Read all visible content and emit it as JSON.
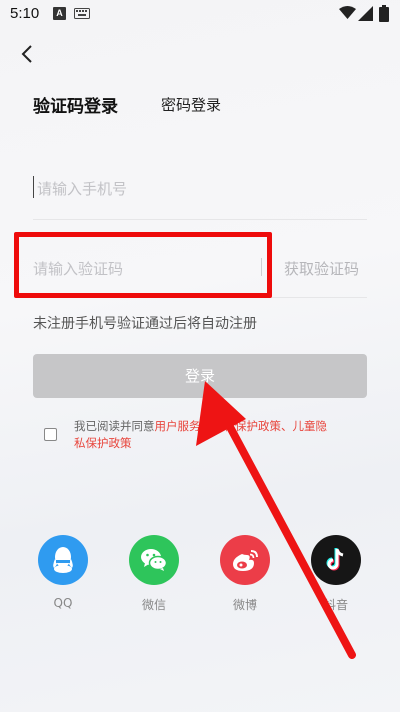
{
  "status_bar": {
    "time": "5:10",
    "notification_badge": "A",
    "icons": [
      "keyboard-icon",
      "wifi-icon",
      "signal-icon",
      "battery-icon"
    ]
  },
  "nav": {
    "back_icon": "chevron-left-icon"
  },
  "tabs": {
    "sms_login": "验证码登录",
    "password_login": "密码登录"
  },
  "phone_field": {
    "placeholder": "请输入手机号",
    "value": ""
  },
  "code_field": {
    "placeholder": "请输入验证码",
    "value": "",
    "get_code": "获取验证码"
  },
  "hint": "未注册手机号验证通过后将自动注册",
  "login_button": "登录",
  "agreement": {
    "checked": false,
    "prefix": "我已阅读并同意",
    "user_service": "用户服务",
    "separator_1": "、",
    "privacy_policy": "隐私保护政策",
    "separator_2": "、",
    "children_privacy_line1": "儿童隐",
    "children_privacy_line2": "私保护政策"
  },
  "social": [
    {
      "label": "QQ",
      "icon": "qq-icon",
      "color": "#2f9bf0"
    },
    {
      "label": "微信",
      "icon": "wechat-icon",
      "color": "#2ec55b"
    },
    {
      "label": "微博",
      "icon": "weibo-icon",
      "color": "#ec3d48"
    },
    {
      "label": "抖音",
      "icon": "douyin-icon",
      "color": "#161616"
    }
  ],
  "colors": {
    "annotation_red": "#ee0b0b",
    "link_red": "#e8453c",
    "button_disabled": "#c6c6c8"
  }
}
